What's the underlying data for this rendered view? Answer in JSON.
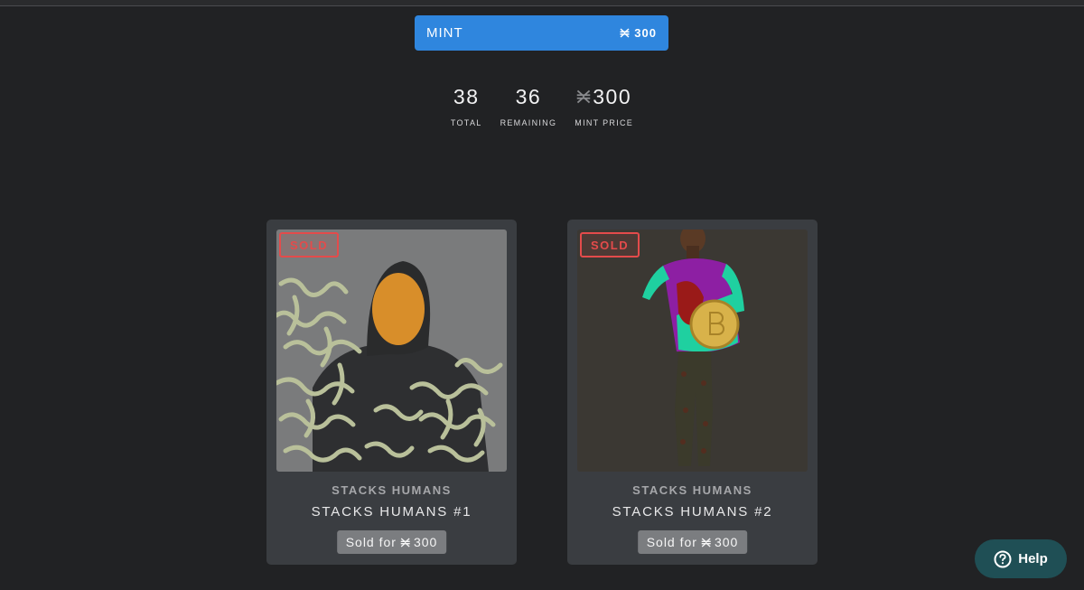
{
  "mint": {
    "label": "MINT",
    "price": "300",
    "currency_icon": "stx-icon"
  },
  "stats": [
    {
      "value": "38",
      "label": "TOTAL"
    },
    {
      "value": "36",
      "label": "REMAINING"
    },
    {
      "value": "300",
      "label": "MINT PRICE"
    }
  ],
  "cards": [
    {
      "badge": "SOLD",
      "collection": "STACKS HUMANS",
      "name": "STACKS HUMANS #1",
      "price_prefix": "Sold for",
      "price": "300"
    },
    {
      "badge": "SOLD",
      "collection": "STACKS HUMANS",
      "name": "STACKS HUMANS #2",
      "price_prefix": "Sold for",
      "price": "300"
    }
  ],
  "help": {
    "label": "Help",
    "icon": "question-circle-icon"
  },
  "colors": {
    "background": "#212224",
    "mint_button": "#2f86de",
    "card": "#3a3d41",
    "sold": "#e44b4b",
    "help_button": "#1f4f55"
  }
}
